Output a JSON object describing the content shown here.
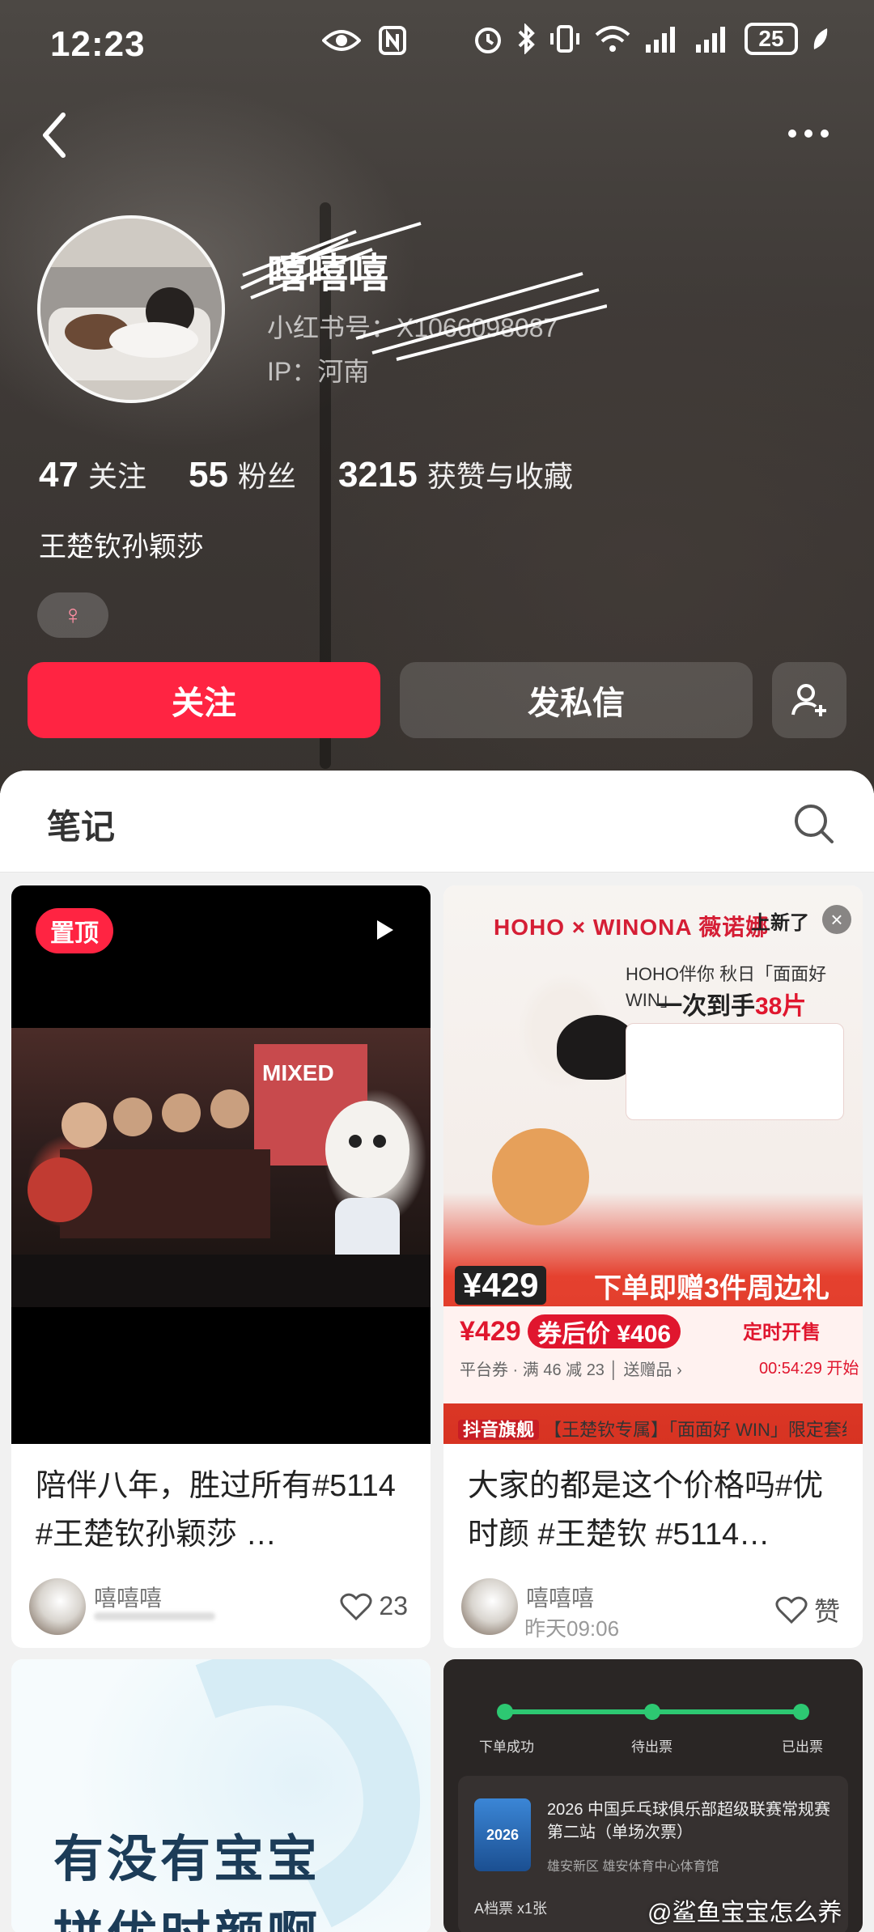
{
  "status_bar": {
    "time": "12:23",
    "battery": "25"
  },
  "profile": {
    "username": "嘻嘻嘻",
    "redbook_id": "小红书号：X1066098087",
    "ip": "IP：河南",
    "stats": [
      {
        "num": "47",
        "label": "关注"
      },
      {
        "num": "55",
        "label": "粉丝"
      },
      {
        "num": "3215",
        "label": "获赞与收藏"
      }
    ],
    "bio": "王楚钦孙颖莎",
    "gender_symbol": "♀"
  },
  "actions": {
    "follow": "关注",
    "message": "发私信"
  },
  "section": {
    "title": "笔记"
  },
  "cards": [
    {
      "pinned": "置顶",
      "banner": "MIXED",
      "text": "陪伴八年，胜过所有#5114 #王楚钦孙颖莎 …",
      "author": "嘻嘻嘻",
      "likes": "23"
    },
    {
      "ad": {
        "brand": "HOHO × WINONA 薇诺娜",
        "new_label": "上新了",
        "close": "×",
        "slogan": "HOHO伴你 秋日「面面好WIN」",
        "slogan2_prefix": "一次到手",
        "slogan2_highlight": "38片",
        "price_tag": "¥429",
        "gift": "下单即赠3件周边礼",
        "price": "¥429",
        "coupon": "券后价 ¥406",
        "coupon_note": "平台券 · 满 46 减 23 │ 送赠品 ›",
        "timer_label": "定时开售",
        "timer": "00:54:29 开始",
        "caption_tag": "抖音旗舰",
        "caption": "【王楚钦专属】「面面好 WIN」限定套组"
      },
      "text": "大家的都是这个价格吗#优时颜 #王楚钦 #5114…",
      "author": "嘻嘻嘻",
      "time": "昨天09:06",
      "likes": "赞"
    },
    {
      "line1": "有没有宝宝",
      "line2": "拼优时颜啊"
    },
    {
      "steps": [
        "下单成功",
        "待出票",
        "已出票"
      ],
      "logo": "2026",
      "title": "2026 中国乒乓球俱乐部超级联赛常规赛第二站（单场次票）",
      "venue": "雄安新区 雄安体育中心体育馆",
      "ticket": "A档票 x1张"
    }
  ],
  "watermark": "@鲨鱼宝宝怎么养"
}
